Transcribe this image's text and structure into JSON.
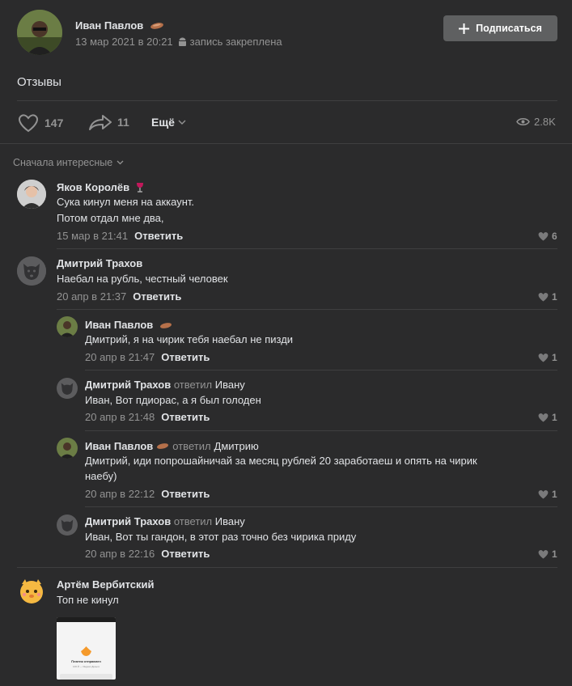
{
  "post": {
    "author": "Иван Павлов",
    "date": "13 мар 2021 в 20:21",
    "pinned_label": "запись закреплена",
    "subscribe_label": "Подписаться",
    "text": "Отзывы",
    "likes": "147",
    "shares": "11",
    "more_label": "Ещё",
    "views": "2.8K"
  },
  "comments_header": {
    "sort_label": "Сначала интересные"
  },
  "comments": [
    {
      "author": "Яков Королёв",
      "lines": [
        "Сука кинул меня на аккаунт.",
        "Потом отдал мне два,"
      ],
      "date": "15 мар в 21:41",
      "reply_label": "Ответить",
      "likes": "6"
    },
    {
      "author": "Дмитрий Трахов",
      "lines": [
        "Наебал на рубль, честный человек"
      ],
      "date": "20 апр в 21:37",
      "reply_label": "Ответить",
      "likes": "1",
      "replies": [
        {
          "author": "Иван Павлов",
          "text": "Дмитрий, я на чирик тебя наебал не пизди",
          "date": "20 апр в 21:47",
          "reply_label": "Ответить",
          "likes": "1"
        },
        {
          "author": "Дмитрий Трахов",
          "replied_word": "ответил",
          "replied_to": "Ивану",
          "text": "Иван, Вот пдиорас, а я был голоден",
          "date": "20 апр в 21:48",
          "reply_label": "Ответить",
          "likes": "1"
        },
        {
          "author": "Иван Павлов",
          "replied_word": "ответил",
          "replied_to": "Дмитрию",
          "text_line1": "Дмитрий, иди попрошайничай за месяц рублей 20 заработаеш и опять на чирик",
          "text_line2": "наебу)",
          "date": "20 апр в 22:12",
          "reply_label": "Ответить",
          "likes": "1"
        },
        {
          "author": "Дмитрий Трахов",
          "replied_word": "ответил",
          "replied_to": "Ивану",
          "text": "Иван, Вот ты гандон, в этот раз точно без чирика приду",
          "date": "20 апр в 22:16",
          "reply_label": "Ответить",
          "likes": "1"
        }
      ]
    },
    {
      "author": "Артём Вербитский",
      "lines": [
        "Топ не кинул"
      ],
      "attachment": {
        "title": "Платеж отправлен",
        "subtitle": "100 ₽ — Яндекс.Деньги"
      }
    }
  ],
  "colors": {
    "background": "#2b2b2c",
    "button": "#5f6061",
    "text": "#e1e3e6",
    "muted": "#939393",
    "divider": "#3f3f40"
  }
}
